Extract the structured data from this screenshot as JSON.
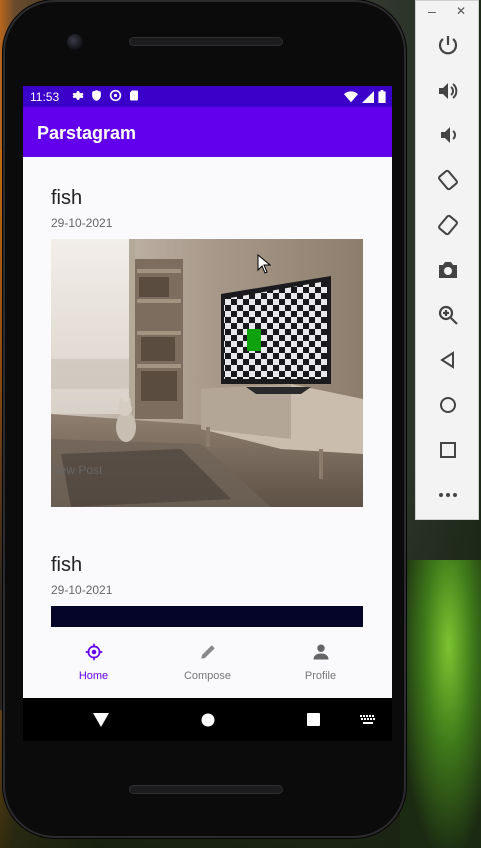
{
  "app": {
    "title": "Parstagram",
    "theme_color": "#6200ee",
    "status_color": "#3a00c9"
  },
  "status_bar": {
    "time": "11:53",
    "left_icons": [
      "settings-icon",
      "shield-icon",
      "data-saver-icon",
      "sd-card-icon"
    ],
    "right_icons": [
      "wifi-icon",
      "signal-icon",
      "battery-icon"
    ]
  },
  "feed": {
    "posts": [
      {
        "username": "fish",
        "date": "29-10-2021",
        "description": "New Post",
        "image": "room-with-tv-and-cat-image"
      },
      {
        "username": "fish",
        "date": "29-10-2021",
        "description": "",
        "image": "dark-navy-image"
      }
    ]
  },
  "bottom_nav": {
    "items": [
      {
        "label": "Home",
        "icon": "home-icon",
        "active": true
      },
      {
        "label": "Compose",
        "icon": "pencil-icon",
        "active": false
      },
      {
        "label": "Profile",
        "icon": "person-icon",
        "active": false
      }
    ]
  },
  "system_nav": [
    "back-icon",
    "home-circle-icon",
    "overview-icon",
    "keyboard-icon"
  ],
  "emulator_toolbar": {
    "window_controls": [
      "minimize",
      "close"
    ],
    "minimize_glyph": "–",
    "close_glyph": "✕",
    "buttons": [
      "power-icon",
      "volume-up-icon",
      "volume-down-icon",
      "rotate-left-icon",
      "rotate-right-icon",
      "camera-icon",
      "zoom-icon",
      "back-icon",
      "home-icon",
      "overview-icon",
      "more-icon"
    ]
  }
}
